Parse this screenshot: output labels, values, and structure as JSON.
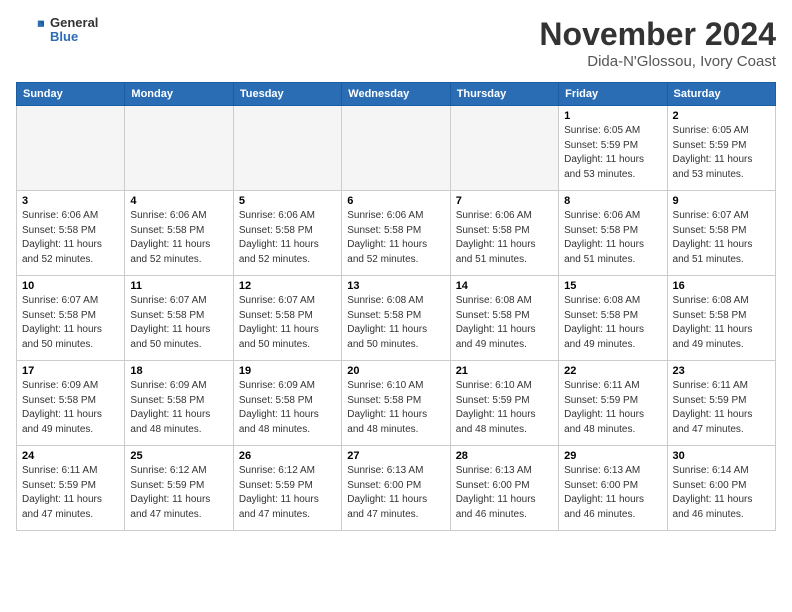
{
  "header": {
    "logo_general": "General",
    "logo_blue": "Blue",
    "month_title": "November 2024",
    "location": "Dida-N'Glossou, Ivory Coast"
  },
  "days_of_week": [
    "Sunday",
    "Monday",
    "Tuesday",
    "Wednesday",
    "Thursday",
    "Friday",
    "Saturday"
  ],
  "weeks": [
    [
      {
        "day": "",
        "info": ""
      },
      {
        "day": "",
        "info": ""
      },
      {
        "day": "",
        "info": ""
      },
      {
        "day": "",
        "info": ""
      },
      {
        "day": "",
        "info": ""
      },
      {
        "day": "1",
        "info": "Sunrise: 6:05 AM\nSunset: 5:59 PM\nDaylight: 11 hours\nand 53 minutes."
      },
      {
        "day": "2",
        "info": "Sunrise: 6:05 AM\nSunset: 5:59 PM\nDaylight: 11 hours\nand 53 minutes."
      }
    ],
    [
      {
        "day": "3",
        "info": "Sunrise: 6:06 AM\nSunset: 5:58 PM\nDaylight: 11 hours\nand 52 minutes."
      },
      {
        "day": "4",
        "info": "Sunrise: 6:06 AM\nSunset: 5:58 PM\nDaylight: 11 hours\nand 52 minutes."
      },
      {
        "day": "5",
        "info": "Sunrise: 6:06 AM\nSunset: 5:58 PM\nDaylight: 11 hours\nand 52 minutes."
      },
      {
        "day": "6",
        "info": "Sunrise: 6:06 AM\nSunset: 5:58 PM\nDaylight: 11 hours\nand 52 minutes."
      },
      {
        "day": "7",
        "info": "Sunrise: 6:06 AM\nSunset: 5:58 PM\nDaylight: 11 hours\nand 51 minutes."
      },
      {
        "day": "8",
        "info": "Sunrise: 6:06 AM\nSunset: 5:58 PM\nDaylight: 11 hours\nand 51 minutes."
      },
      {
        "day": "9",
        "info": "Sunrise: 6:07 AM\nSunset: 5:58 PM\nDaylight: 11 hours\nand 51 minutes."
      }
    ],
    [
      {
        "day": "10",
        "info": "Sunrise: 6:07 AM\nSunset: 5:58 PM\nDaylight: 11 hours\nand 50 minutes."
      },
      {
        "day": "11",
        "info": "Sunrise: 6:07 AM\nSunset: 5:58 PM\nDaylight: 11 hours\nand 50 minutes."
      },
      {
        "day": "12",
        "info": "Sunrise: 6:07 AM\nSunset: 5:58 PM\nDaylight: 11 hours\nand 50 minutes."
      },
      {
        "day": "13",
        "info": "Sunrise: 6:08 AM\nSunset: 5:58 PM\nDaylight: 11 hours\nand 50 minutes."
      },
      {
        "day": "14",
        "info": "Sunrise: 6:08 AM\nSunset: 5:58 PM\nDaylight: 11 hours\nand 49 minutes."
      },
      {
        "day": "15",
        "info": "Sunrise: 6:08 AM\nSunset: 5:58 PM\nDaylight: 11 hours\nand 49 minutes."
      },
      {
        "day": "16",
        "info": "Sunrise: 6:08 AM\nSunset: 5:58 PM\nDaylight: 11 hours\nand 49 minutes."
      }
    ],
    [
      {
        "day": "17",
        "info": "Sunrise: 6:09 AM\nSunset: 5:58 PM\nDaylight: 11 hours\nand 49 minutes."
      },
      {
        "day": "18",
        "info": "Sunrise: 6:09 AM\nSunset: 5:58 PM\nDaylight: 11 hours\nand 48 minutes."
      },
      {
        "day": "19",
        "info": "Sunrise: 6:09 AM\nSunset: 5:58 PM\nDaylight: 11 hours\nand 48 minutes."
      },
      {
        "day": "20",
        "info": "Sunrise: 6:10 AM\nSunset: 5:58 PM\nDaylight: 11 hours\nand 48 minutes."
      },
      {
        "day": "21",
        "info": "Sunrise: 6:10 AM\nSunset: 5:59 PM\nDaylight: 11 hours\nand 48 minutes."
      },
      {
        "day": "22",
        "info": "Sunrise: 6:11 AM\nSunset: 5:59 PM\nDaylight: 11 hours\nand 48 minutes."
      },
      {
        "day": "23",
        "info": "Sunrise: 6:11 AM\nSunset: 5:59 PM\nDaylight: 11 hours\nand 47 minutes."
      }
    ],
    [
      {
        "day": "24",
        "info": "Sunrise: 6:11 AM\nSunset: 5:59 PM\nDaylight: 11 hours\nand 47 minutes."
      },
      {
        "day": "25",
        "info": "Sunrise: 6:12 AM\nSunset: 5:59 PM\nDaylight: 11 hours\nand 47 minutes."
      },
      {
        "day": "26",
        "info": "Sunrise: 6:12 AM\nSunset: 5:59 PM\nDaylight: 11 hours\nand 47 minutes."
      },
      {
        "day": "27",
        "info": "Sunrise: 6:13 AM\nSunset: 6:00 PM\nDaylight: 11 hours\nand 47 minutes."
      },
      {
        "day": "28",
        "info": "Sunrise: 6:13 AM\nSunset: 6:00 PM\nDaylight: 11 hours\nand 46 minutes."
      },
      {
        "day": "29",
        "info": "Sunrise: 6:13 AM\nSunset: 6:00 PM\nDaylight: 11 hours\nand 46 minutes."
      },
      {
        "day": "30",
        "info": "Sunrise: 6:14 AM\nSunset: 6:00 PM\nDaylight: 11 hours\nand 46 minutes."
      }
    ]
  ]
}
